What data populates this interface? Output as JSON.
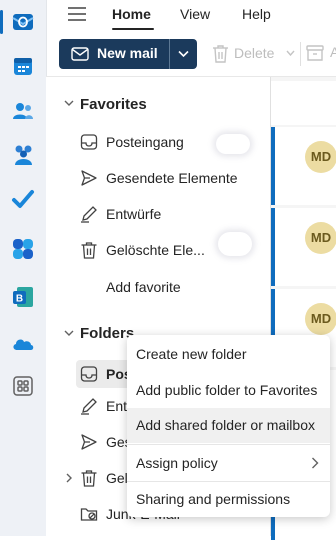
{
  "nav": {
    "tabs": [
      "Home",
      "View",
      "Help"
    ],
    "active_tab": "Home"
  },
  "ribbon": {
    "new_mail": "New mail",
    "delete": "Delete",
    "archive_partial": "A"
  },
  "rail": {
    "apps": [
      "outlook-icon",
      "calendar-icon",
      "people-icon",
      "teams-icon",
      "todo-icon",
      "copilot-icon",
      "bookings-icon",
      "onedrive-icon",
      "more-apps-icon"
    ],
    "accent": "#0f6cbd"
  },
  "favorites": {
    "title": "Favorites",
    "items": [
      {
        "label": "Posteingang",
        "icon": "inbox-icon"
      },
      {
        "label": "Gesendete Elemente",
        "icon": "send-icon"
      },
      {
        "label": "Entwürfe",
        "icon": "draft-icon"
      },
      {
        "label": "Gelöschte Ele...",
        "icon": "trash-icon"
      }
    ],
    "add": "Add favorite"
  },
  "folders": {
    "title": "Folders",
    "items": [
      {
        "label": "Pos",
        "icon": "inbox-icon"
      },
      {
        "label": "Entw",
        "icon": "draft-icon"
      },
      {
        "label": "Ges",
        "icon": "send-icon"
      },
      {
        "label": "Gelö",
        "icon": "trash-icon"
      },
      {
        "label": "Junk-E-Mail",
        "icon": "junk-icon"
      }
    ]
  },
  "mail_list": {
    "avatars": [
      "MD",
      "MD",
      "MD"
    ],
    "avatar_color": "#ecdca2"
  },
  "context_menu": {
    "items": [
      "Create new folder",
      "Add public folder to Favorites",
      "Add shared folder or mailbox",
      "Assign policy",
      "Sharing and permissions"
    ]
  }
}
